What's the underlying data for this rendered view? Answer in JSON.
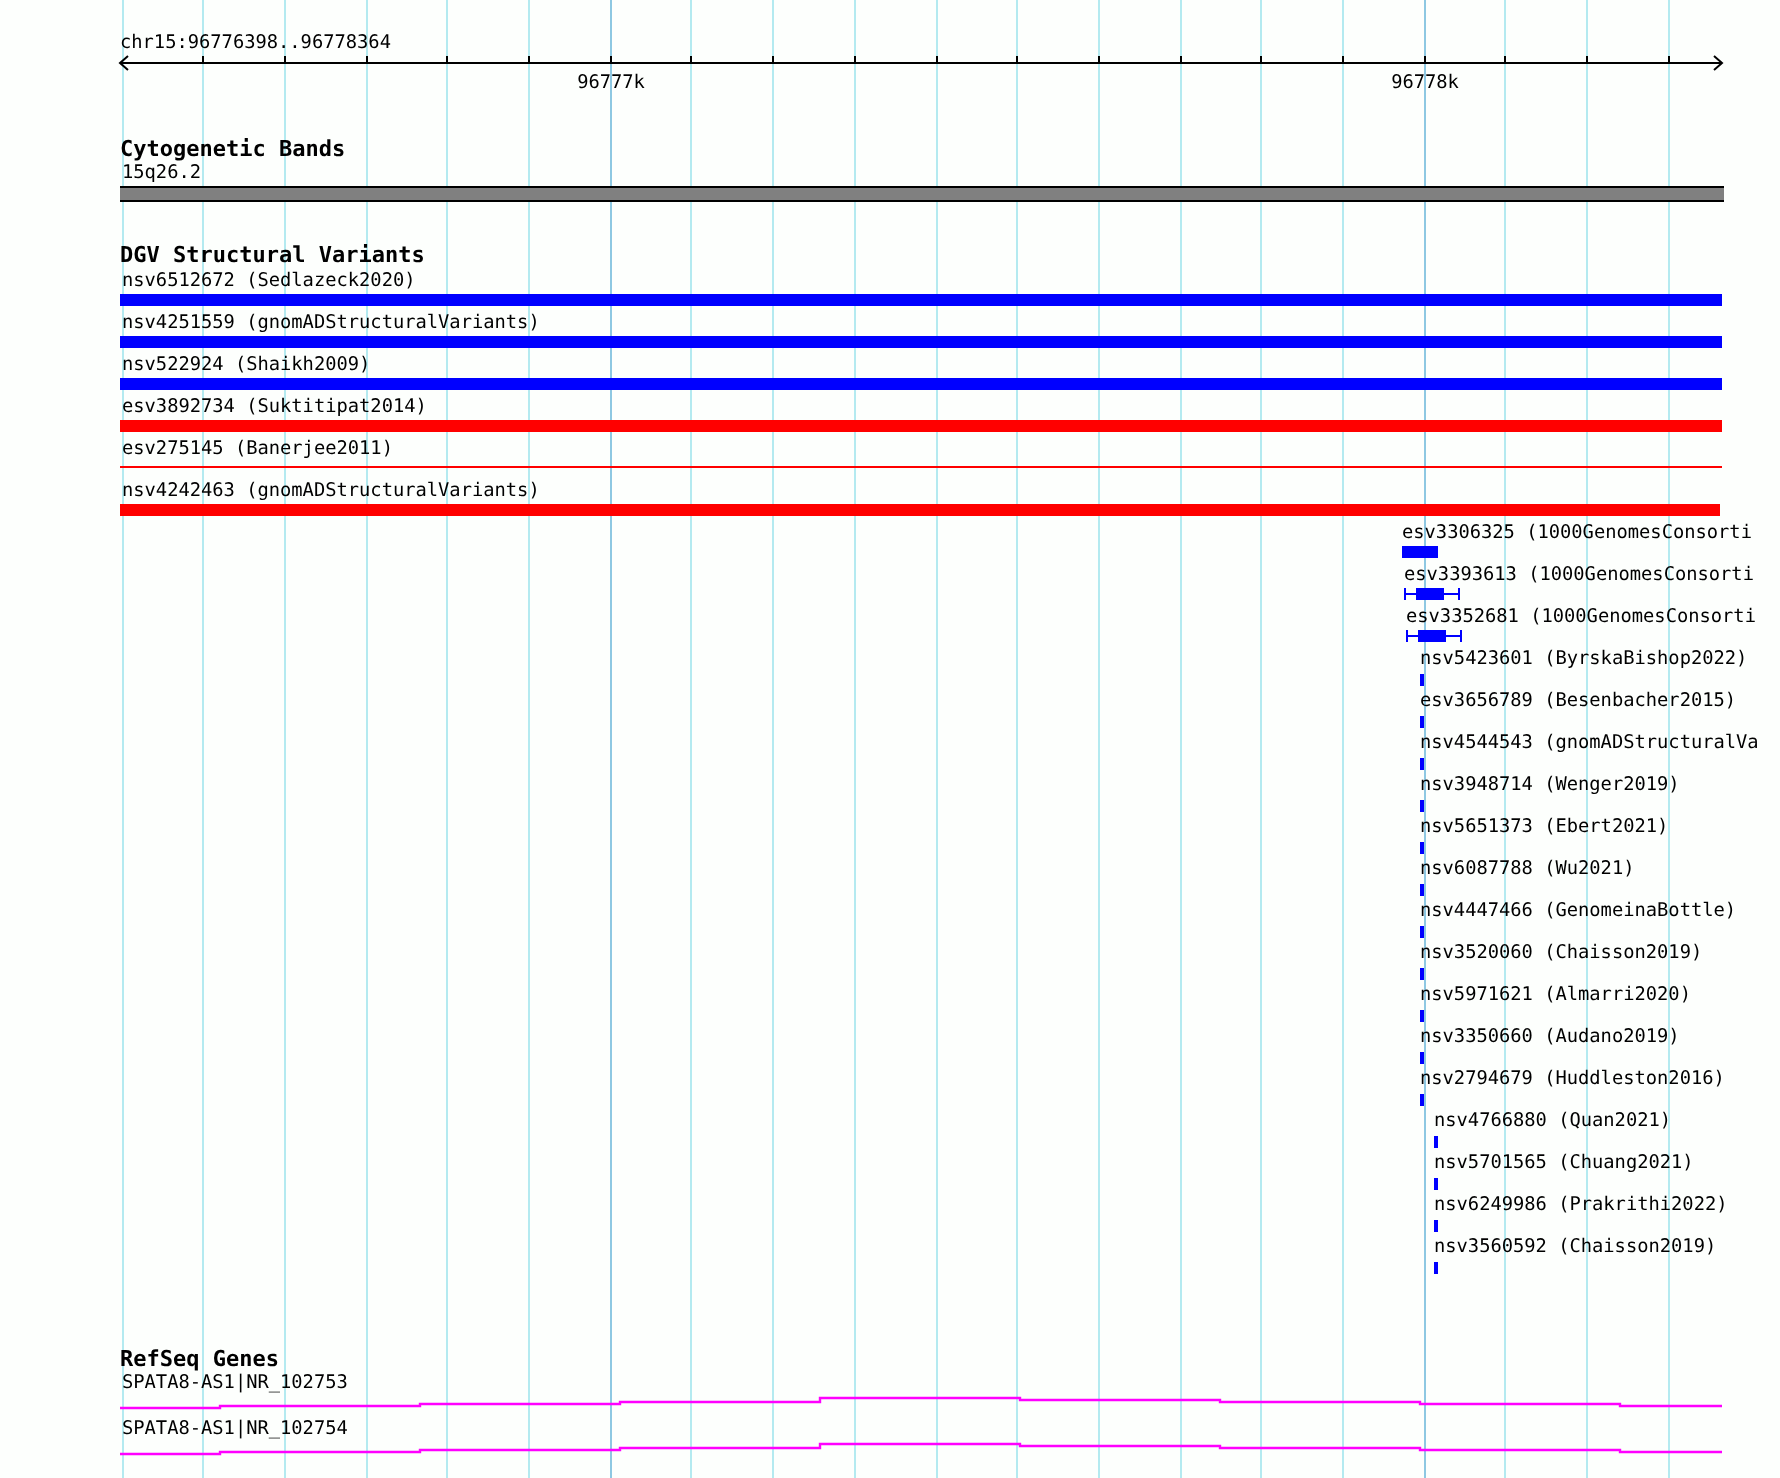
{
  "ruler": {
    "location": "chr15:96776398..96778364",
    "ticks": [
      "96777k",
      "96778k"
    ]
  },
  "cytogenetic_bands": {
    "title": "Cytogenetic Bands",
    "features": [
      {
        "label": "15q26.2",
        "kind": "band"
      }
    ]
  },
  "dgv_structural_variants": {
    "title": "DGV Structural Variants",
    "features": [
      {
        "label": "nsv6512672 (Sedlazeck2020)",
        "kind": "bar",
        "color": "#0000ff"
      },
      {
        "label": "nsv4251559 (gnomADStructuralVariants)",
        "kind": "bar",
        "color": "#0000ff"
      },
      {
        "label": "nsv522924 (Shaikh2009)",
        "kind": "bar",
        "color": "#0000ff"
      },
      {
        "label": "esv3892734 (Suktitipat2014)",
        "kind": "bar",
        "color": "#ff0000"
      },
      {
        "label": "esv275145 (Banerjee2011)",
        "kind": "line",
        "color": "#ff0000"
      },
      {
        "label": "nsv4242463 (gnomADStructuralVariants)",
        "kind": "bar",
        "color": "#ff0000"
      },
      {
        "label": "esv3306325 (1000GenomesConsorti",
        "kind": "bar",
        "color": "#0000ff"
      },
      {
        "label": "esv3393613 (1000GenomesConsorti",
        "kind": "whisker",
        "color": "#0000ff"
      },
      {
        "label": "esv3352681 (1000GenomesConsorti",
        "kind": "whisker",
        "color": "#0000ff"
      },
      {
        "label": "nsv5423601 (ByrskaBishop2022)",
        "kind": "tick",
        "color": "#0000ff"
      },
      {
        "label": "esv3656789 (Besenbacher2015)",
        "kind": "tick",
        "color": "#0000ff"
      },
      {
        "label": "nsv4544543 (gnomADStructuralVa",
        "kind": "tick",
        "color": "#0000ff"
      },
      {
        "label": "nsv3948714 (Wenger2019)",
        "kind": "tick",
        "color": "#0000ff"
      },
      {
        "label": "nsv5651373 (Ebert2021)",
        "kind": "tick",
        "color": "#0000ff"
      },
      {
        "label": "nsv6087788 (Wu2021)",
        "kind": "tick",
        "color": "#0000ff"
      },
      {
        "label": "nsv4447466 (GenomeinaBottle)",
        "kind": "tick",
        "color": "#0000ff"
      },
      {
        "label": "nsv3520060 (Chaisson2019)",
        "kind": "tick",
        "color": "#0000ff"
      },
      {
        "label": "nsv5971621 (Almarri2020)",
        "kind": "tick",
        "color": "#0000ff"
      },
      {
        "label": "nsv3350660 (Audano2019)",
        "kind": "tick",
        "color": "#0000ff"
      },
      {
        "label": "nsv2794679 (Huddleston2016)",
        "kind": "tick",
        "color": "#0000ff"
      },
      {
        "label": "nsv4766880 (Quan2021)",
        "kind": "tick",
        "color": "#0000ff"
      },
      {
        "label": "nsv5701565 (Chuang2021)",
        "kind": "tick",
        "color": "#0000ff"
      },
      {
        "label": "nsv6249986 (Prakrithi2022)",
        "kind": "tick",
        "color": "#0000ff"
      },
      {
        "label": "nsv3560592 (Chaisson2019)",
        "kind": "tick",
        "color": "#0000ff"
      }
    ]
  },
  "refseq_genes": {
    "title": "RefSeq Genes",
    "features": [
      {
        "label": "SPATA8-AS1|NR_102753",
        "kind": "gene"
      },
      {
        "label": "SPATA8-AS1|NR_102754",
        "kind": "gene"
      }
    ]
  }
}
